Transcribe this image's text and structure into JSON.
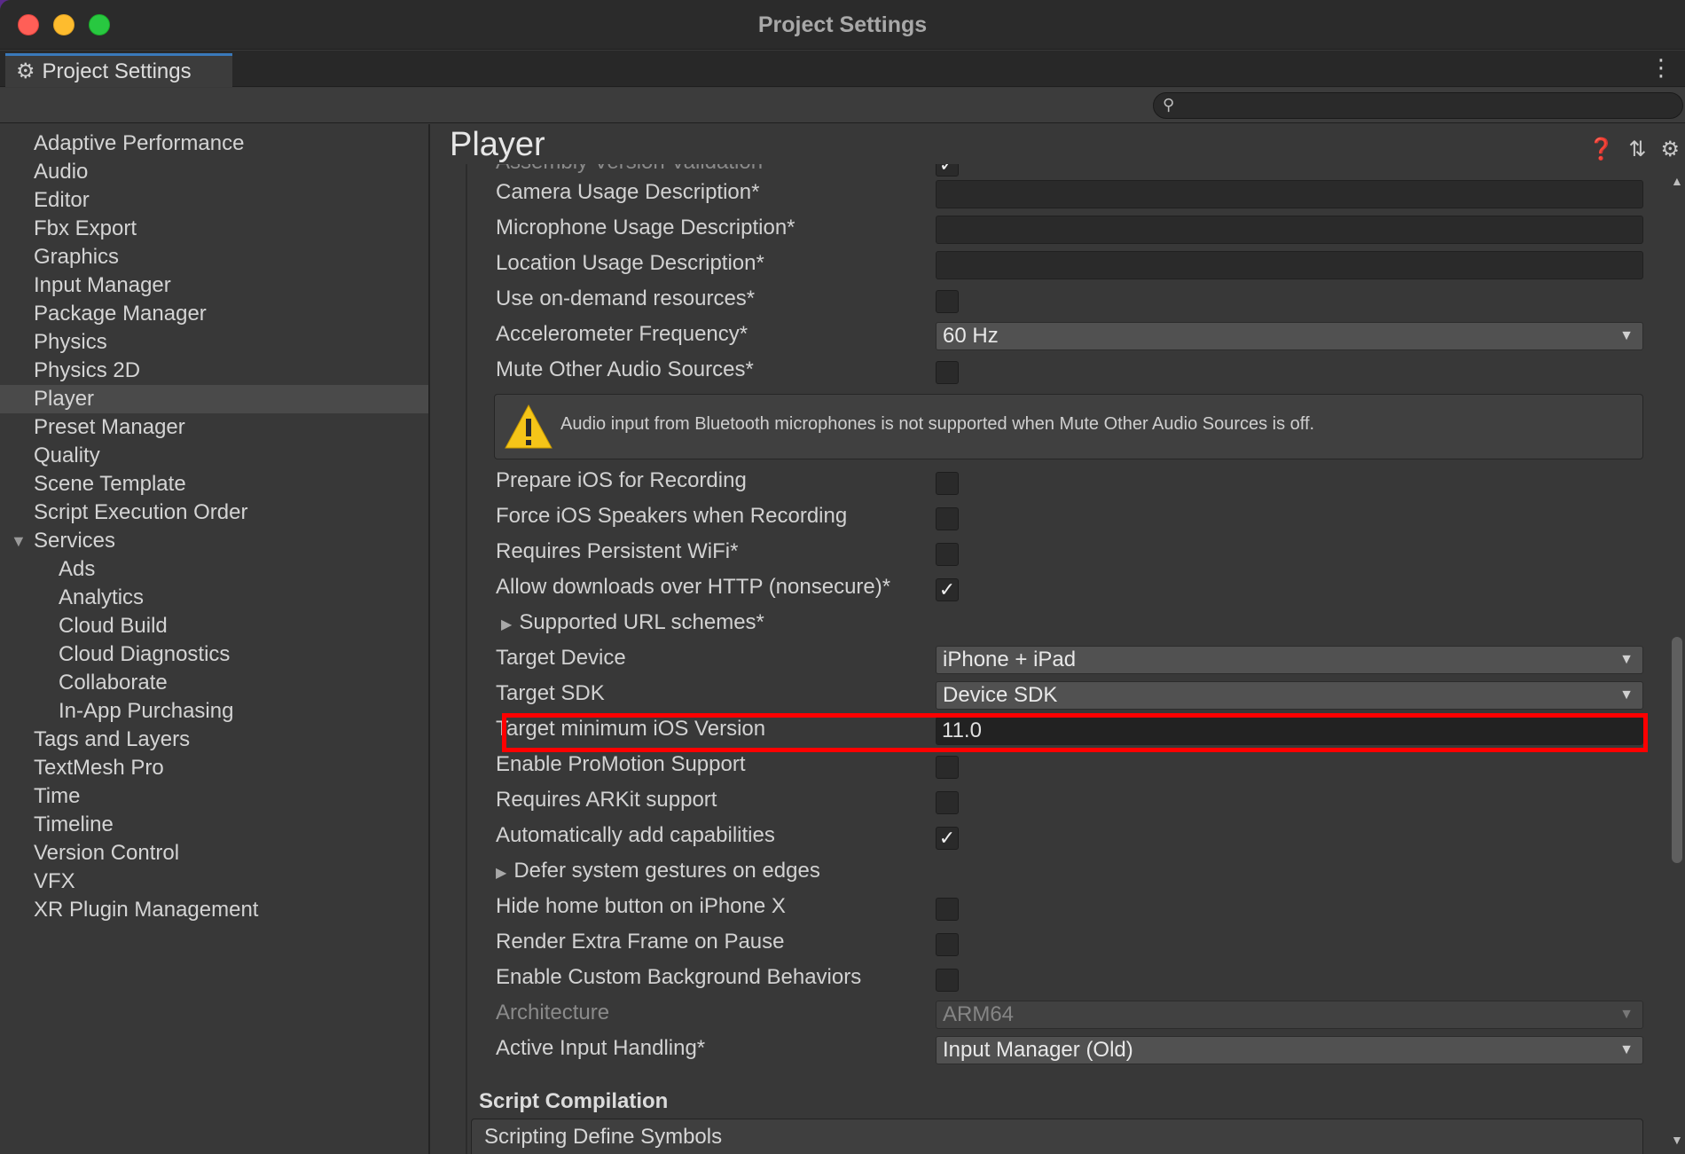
{
  "window": {
    "title": "Project Settings"
  },
  "tab": {
    "label": "Project Settings",
    "icon": "gear-icon"
  },
  "search": {
    "placeholder": ""
  },
  "sidebar": {
    "items": [
      {
        "label": "Adaptive Performance"
      },
      {
        "label": "Audio"
      },
      {
        "label": "Editor"
      },
      {
        "label": "Fbx Export"
      },
      {
        "label": "Graphics"
      },
      {
        "label": "Input Manager"
      },
      {
        "label": "Package Manager"
      },
      {
        "label": "Physics"
      },
      {
        "label": "Physics 2D"
      },
      {
        "label": "Player",
        "selected": true
      },
      {
        "label": "Preset Manager"
      },
      {
        "label": "Quality"
      },
      {
        "label": "Scene Template"
      },
      {
        "label": "Script Execution Order"
      },
      {
        "label": "Services",
        "expanded": true
      },
      {
        "label": "Ads",
        "child": true
      },
      {
        "label": "Analytics",
        "child": true
      },
      {
        "label": "Cloud Build",
        "child": true
      },
      {
        "label": "Cloud Diagnostics",
        "child": true
      },
      {
        "label": "Collaborate",
        "child": true
      },
      {
        "label": "In-App Purchasing",
        "child": true
      },
      {
        "label": "Tags and Layers"
      },
      {
        "label": "TextMesh Pro"
      },
      {
        "label": "Time"
      },
      {
        "label": "Timeline"
      },
      {
        "label": "Version Control"
      },
      {
        "label": "VFX"
      },
      {
        "label": "XR Plugin Management"
      }
    ]
  },
  "main": {
    "title": "Player",
    "rows": {
      "assembly_version_validation": "Assembly Version Validation",
      "camera_usage": {
        "label": "Camera Usage Description*",
        "value": ""
      },
      "microphone_usage": {
        "label": "Microphone Usage Description*",
        "value": ""
      },
      "location_usage": {
        "label": "Location Usage Description*",
        "value": ""
      },
      "on_demand_resources": {
        "label": "Use on-demand resources*",
        "checked": false
      },
      "accelerometer_frequency": {
        "label": "Accelerometer Frequency*",
        "value": "60 Hz"
      },
      "mute_other_audio": {
        "label": "Mute Other Audio Sources*",
        "checked": false
      },
      "warning": "Audio input from Bluetooth microphones is not supported when Mute Other Audio Sources is off.",
      "prepare_ios_recording": {
        "label": "Prepare iOS for Recording",
        "checked": false
      },
      "force_ios_speakers": {
        "label": "Force iOS Speakers when Recording",
        "checked": false
      },
      "persistent_wifi": {
        "label": "Requires Persistent WiFi*",
        "checked": false
      },
      "allow_http": {
        "label": "Allow downloads over HTTP (nonsecure)*",
        "checked": true
      },
      "supported_url_schemes": "Supported URL schemes*",
      "target_device": {
        "label": "Target Device",
        "value": "iPhone + iPad"
      },
      "target_sdk": {
        "label": "Target SDK",
        "value": "Device SDK"
      },
      "target_min_ios": {
        "label": "Target minimum iOS Version",
        "value": "11.0"
      },
      "promotion_support": {
        "label": "Enable ProMotion Support",
        "checked": false
      },
      "arkit_support": {
        "label": "Requires ARKit support",
        "checked": false
      },
      "auto_capabilities": {
        "label": "Automatically add capabilities",
        "checked": true
      },
      "defer_gestures": "Defer system gestures on edges",
      "hide_home_button": {
        "label": "Hide home button on iPhone X",
        "checked": false
      },
      "render_extra_frame": {
        "label": "Render Extra Frame on Pause",
        "checked": false
      },
      "custom_background": {
        "label": "Enable Custom Background Behaviors",
        "checked": false
      },
      "architecture": {
        "label": "Architecture",
        "value": "ARM64"
      },
      "active_input_handling": {
        "label": "Active Input Handling*",
        "value": "Input Manager (Old)"
      }
    },
    "script_compilation": {
      "title": "Script Compilation",
      "scripting_define_symbols": "Scripting Define Symbols"
    }
  },
  "colors": {
    "accent": "#3a79bb",
    "highlight": "#ff0000",
    "warning": "#f5c518"
  }
}
